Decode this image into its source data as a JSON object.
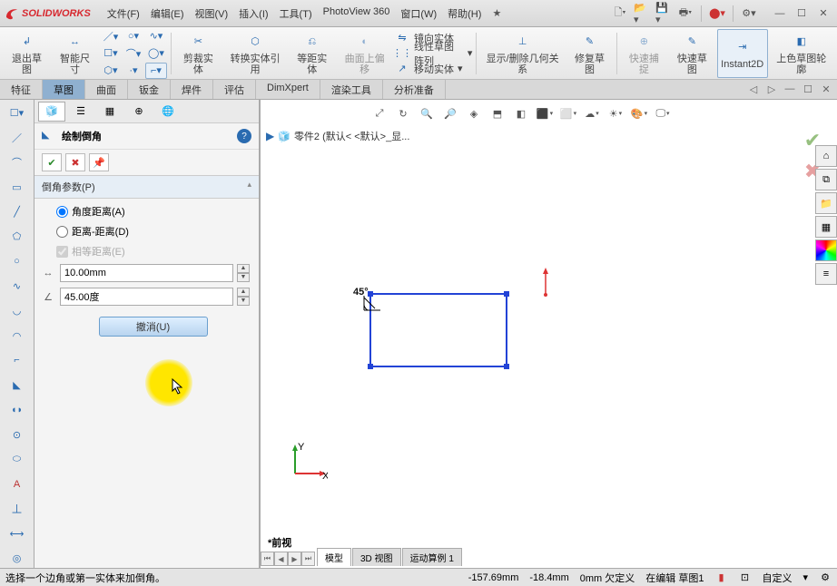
{
  "app_name": "SOLIDWORKS",
  "menus": [
    "文件(F)",
    "编辑(E)",
    "视图(V)",
    "插入(I)",
    "工具(T)",
    "PhotoView 360",
    "窗口(W)",
    "帮助(H)"
  ],
  "ribbon": {
    "btn_exit_sketch": "退出草图",
    "btn_smart_dim": "智能尺寸",
    "btn_trim": "剪裁实体",
    "btn_convert": "转换实体引用",
    "btn_equidist": "等距实体",
    "btn_surface_eq": "曲面上偏移",
    "stack_mirror": "镜向实体",
    "stack_pattern": "线性草图阵列",
    "stack_move": "移动实体",
    "btn_show_rel": "显示/删除几何关系",
    "btn_repair": "修复草图",
    "btn_quick_snap": "快速捕捉",
    "btn_quick_sk": "快速草图",
    "btn_instant2d": "Instant2D",
    "btn_contour": "上色草图轮廓"
  },
  "command_tabs": [
    "特征",
    "草图",
    "曲面",
    "钣金",
    "焊件",
    "评估",
    "DimXpert",
    "渲染工具",
    "分析准备"
  ],
  "active_command_tab": 1,
  "panel": {
    "title": "绘制倒角",
    "section_hdr": "倒角参数(P)",
    "radio_angle_dist": "角度距离(A)",
    "radio_dist_dist": "距离-距离(D)",
    "check_equal": "相等距离(E)",
    "dist_value": "10.00mm",
    "angle_value": "45.00度",
    "undo_btn": "撤消(U)"
  },
  "crumb": "零件2  (默认< <默认>_显...",
  "chamfer_label": "45°",
  "view_label": "*前视",
  "bottom_tabs": [
    "模型",
    "3D 视图",
    "运动算例 1"
  ],
  "status": {
    "prompt": "选择一个边角或第一实体来加倒角。",
    "x": "-157.69mm",
    "y": "-18.4mm",
    "z": "0mm",
    "underdef": "欠定义",
    "edit": "在编辑 草图1",
    "custom": "自定义"
  }
}
